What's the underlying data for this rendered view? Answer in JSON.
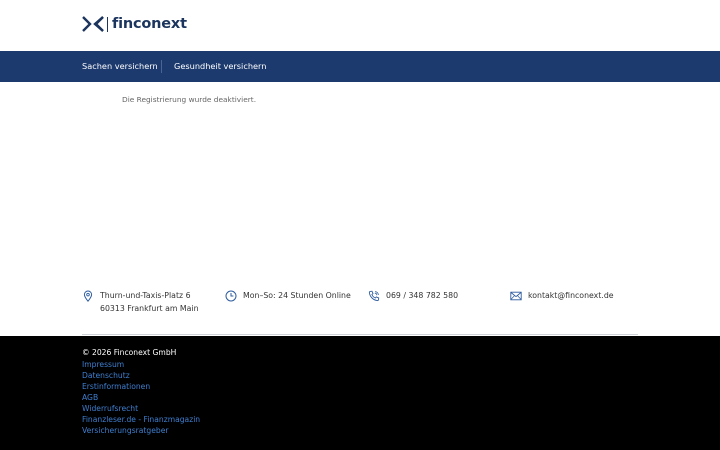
{
  "brand": {
    "name": "finconext",
    "color": "#1c355e",
    "icon": "finconext-logo-icon"
  },
  "nav": {
    "background": "#1c3a6e",
    "items": [
      {
        "label": "Sachen versichern"
      },
      {
        "label": "Gesundheit versichern"
      }
    ]
  },
  "main": {
    "message": "Die Registrierung wurde deaktiviert."
  },
  "contact": {
    "accent": "#2e5c9e",
    "items": [
      {
        "icon": "location-pin-icon",
        "lines": [
          "Thurn-und-Taxis-Platz 6",
          "60313 Frankfurt am Main"
        ]
      },
      {
        "icon": "clock-icon",
        "lines": [
          "Mon–So: 24 Stunden Online"
        ]
      },
      {
        "icon": "phone-icon",
        "lines": [
          "069 / 348 782 580"
        ]
      },
      {
        "icon": "mail-icon",
        "lines": [
          "kontakt@finconext.de"
        ]
      }
    ]
  },
  "footer": {
    "copyright": "© 2026 Finconext GmbH",
    "link_color": "#3f7fd0",
    "links": [
      {
        "label": "Impressum"
      },
      {
        "label": "Datenschutz"
      },
      {
        "label": "Erstinformationen"
      },
      {
        "label": "AGB"
      },
      {
        "label": "Widerrufsrecht"
      },
      {
        "label": "Finanzleser.de - Finanzmagazin"
      },
      {
        "label": "Versicherungsratgeber"
      }
    ]
  }
}
